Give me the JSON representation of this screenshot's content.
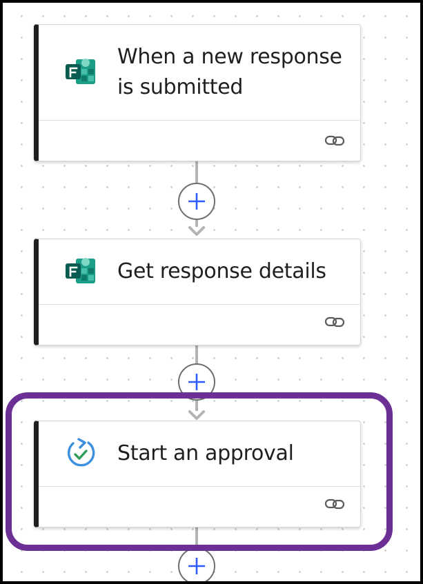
{
  "flow": {
    "steps": [
      {
        "title": "When a new response is submitted",
        "icon": "microsoft-forms-icon"
      },
      {
        "title": "Get response details",
        "icon": "microsoft-forms-icon"
      },
      {
        "title": "Start an approval",
        "icon": "approval-icon"
      }
    ],
    "footer_icon": "link-icon",
    "add_step_icon": "plus-icon",
    "selected_step_index": 2
  },
  "colors": {
    "card_accent": "#1f1f1f",
    "selection_outline": "#6b2f96",
    "add_button_plus": "#2e5bff",
    "connector": "#b3b3b3",
    "forms_primary": "#107c6c",
    "approval_blue": "#3b8fdd",
    "approval_check": "#2e9e5a"
  }
}
